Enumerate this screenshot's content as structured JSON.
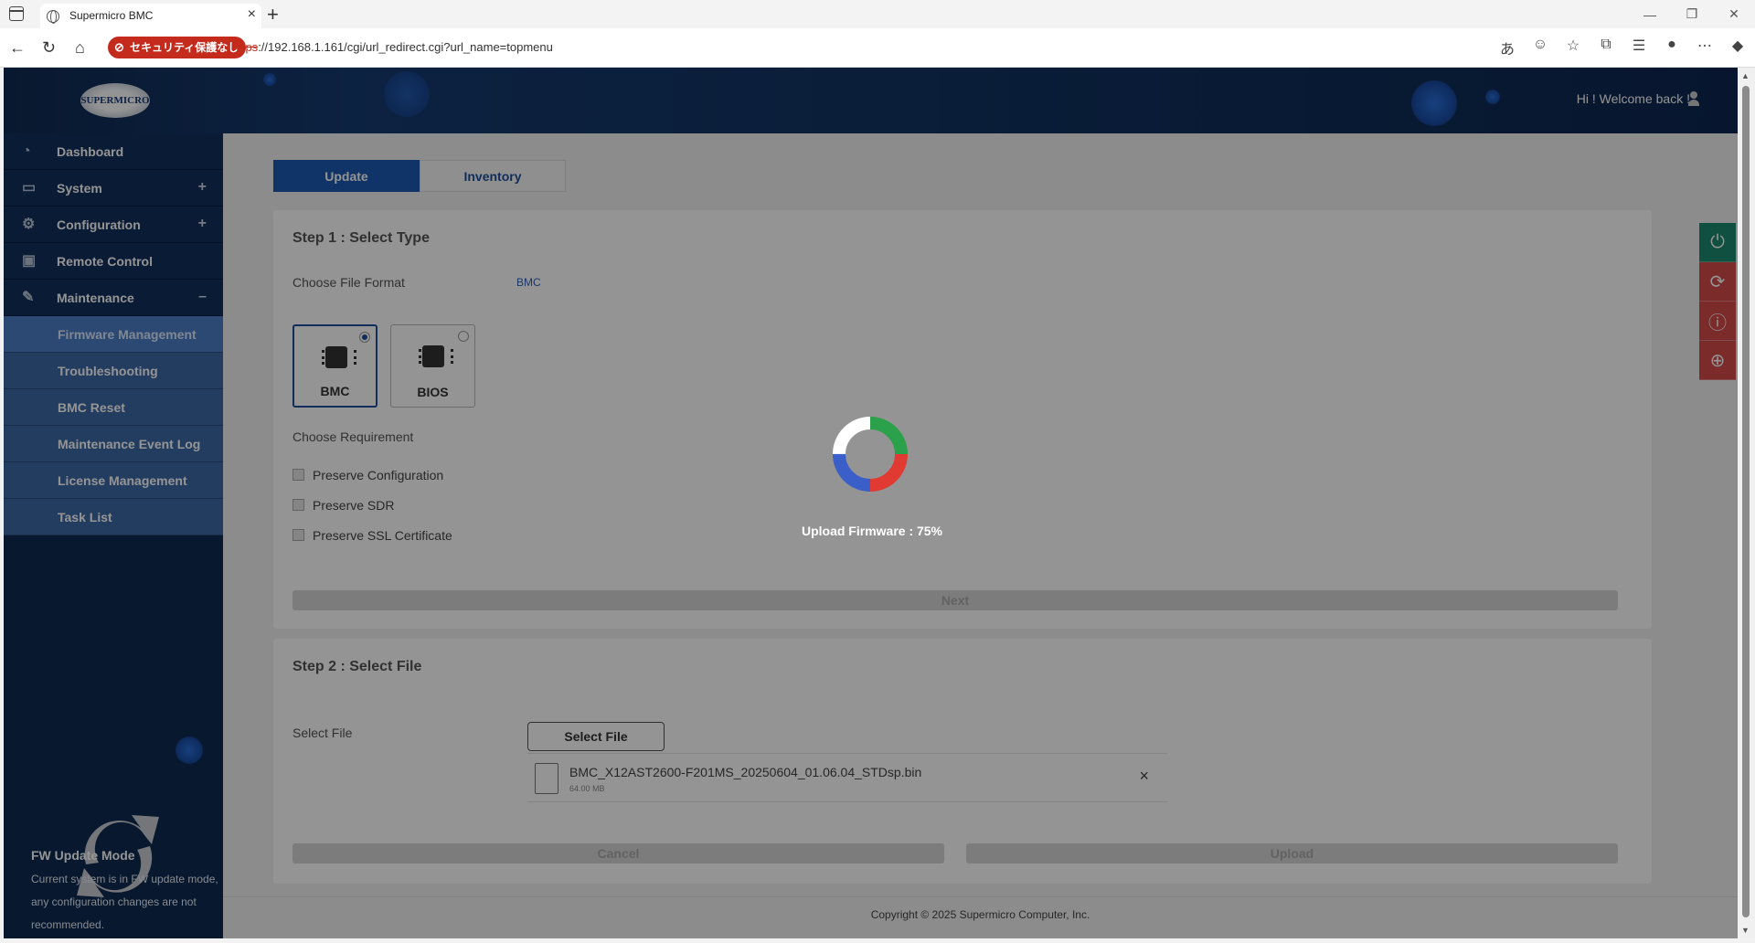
{
  "browser": {
    "tab_title": "Supermicro BMC",
    "security_badge": "セキュリティ保護なし",
    "url_proto": "https",
    "url_rest": "://192.168.1.161/cgi/url_redirect.cgi?url_name=topmenu"
  },
  "header": {
    "logo_text": "SUPERMICRO",
    "welcome": "Hi ! Welcome back !"
  },
  "sidebar": {
    "items": [
      {
        "label": "Dashboard",
        "icon": "gauge-icon",
        "toggle": ""
      },
      {
        "label": "System",
        "icon": "laptop-icon",
        "toggle": "+"
      },
      {
        "label": "Configuration",
        "icon": "gear-icon",
        "toggle": "+"
      },
      {
        "label": "Remote Control",
        "icon": "monitor-icon",
        "toggle": ""
      },
      {
        "label": "Maintenance",
        "icon": "wrench-icon",
        "toggle": "–"
      }
    ],
    "sub_items": [
      "Firmware Management",
      "Troubleshooting",
      "BMC Reset",
      "Maintenance Event Log",
      "License Management",
      "Task List"
    ],
    "fw_mode_title": "FW Update Mode",
    "fw_mode_desc": "Current system is in FW update mode, any configuration changes are not recommended."
  },
  "tabs": [
    "Update",
    "Inventory"
  ],
  "step1": {
    "title": "Step 1 : Select Type",
    "format_label": "Choose File Format",
    "format_value": "BMC",
    "types": [
      "BMC",
      "BIOS"
    ],
    "requirement_label": "Choose Requirement",
    "checkboxes": [
      "Preserve Configuration",
      "Preserve SDR",
      "Preserve SSL Certificate"
    ],
    "next": "Next"
  },
  "step2": {
    "title": "Step 2 : Select File",
    "file_label": "Select File",
    "select_button": "Select File",
    "file_name": "BMC_X12AST2600-F201MS_20250604_01.06.04_STDsp.bin",
    "file_size": "64.00 MB",
    "cancel": "Cancel",
    "upload": "Upload"
  },
  "footer": "Copyright © 2025 Supermicro Computer, Inc.",
  "overlay": {
    "progress_text": "Upload Firmware : 75%",
    "progress_percent": 75
  },
  "colors": {
    "primary": "#1e5ab4",
    "sidebar": "#12305c",
    "power_green": "#1d8a6e",
    "tool_red": "#d64a4a"
  }
}
